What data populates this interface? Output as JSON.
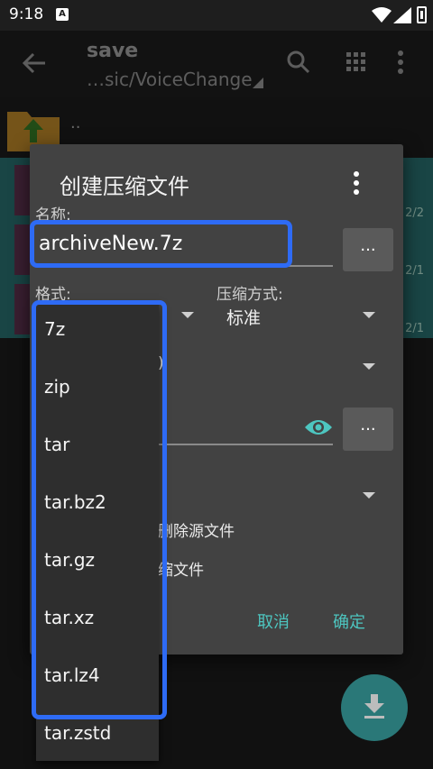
{
  "status_bar": {
    "time": "9:18",
    "notification_icon": "A"
  },
  "toolbar": {
    "title": "save",
    "path": "…sic/VoiceChange"
  },
  "file_list": {
    "parent_label": "..",
    "row_counts": [
      "2/2",
      "2/1",
      "2/1"
    ]
  },
  "dialog": {
    "title": "创建压缩文件",
    "name_label": "名称:",
    "name_value": "archiveNew.7z",
    "browse_label": "...",
    "format_label": "格式:",
    "method_label": "压缩方式:",
    "method_value": "标准",
    "partial_paren": ")",
    "password_browse_label": "...",
    "partial_delete_source": "删除源文件",
    "partial_archive_file": "缩文件",
    "cancel_label": "取消",
    "ok_label": "确定"
  },
  "format_dropdown": {
    "options": [
      "7z",
      "zip",
      "tar",
      "tar.bz2",
      "tar.gz",
      "tar.xz",
      "tar.lz4",
      "tar.zstd"
    ]
  },
  "colors": {
    "accent": "#4dc6c0",
    "highlight": "#2e6bf5",
    "dialog_bg": "#424242",
    "teal_row": "#2f7e7e"
  }
}
